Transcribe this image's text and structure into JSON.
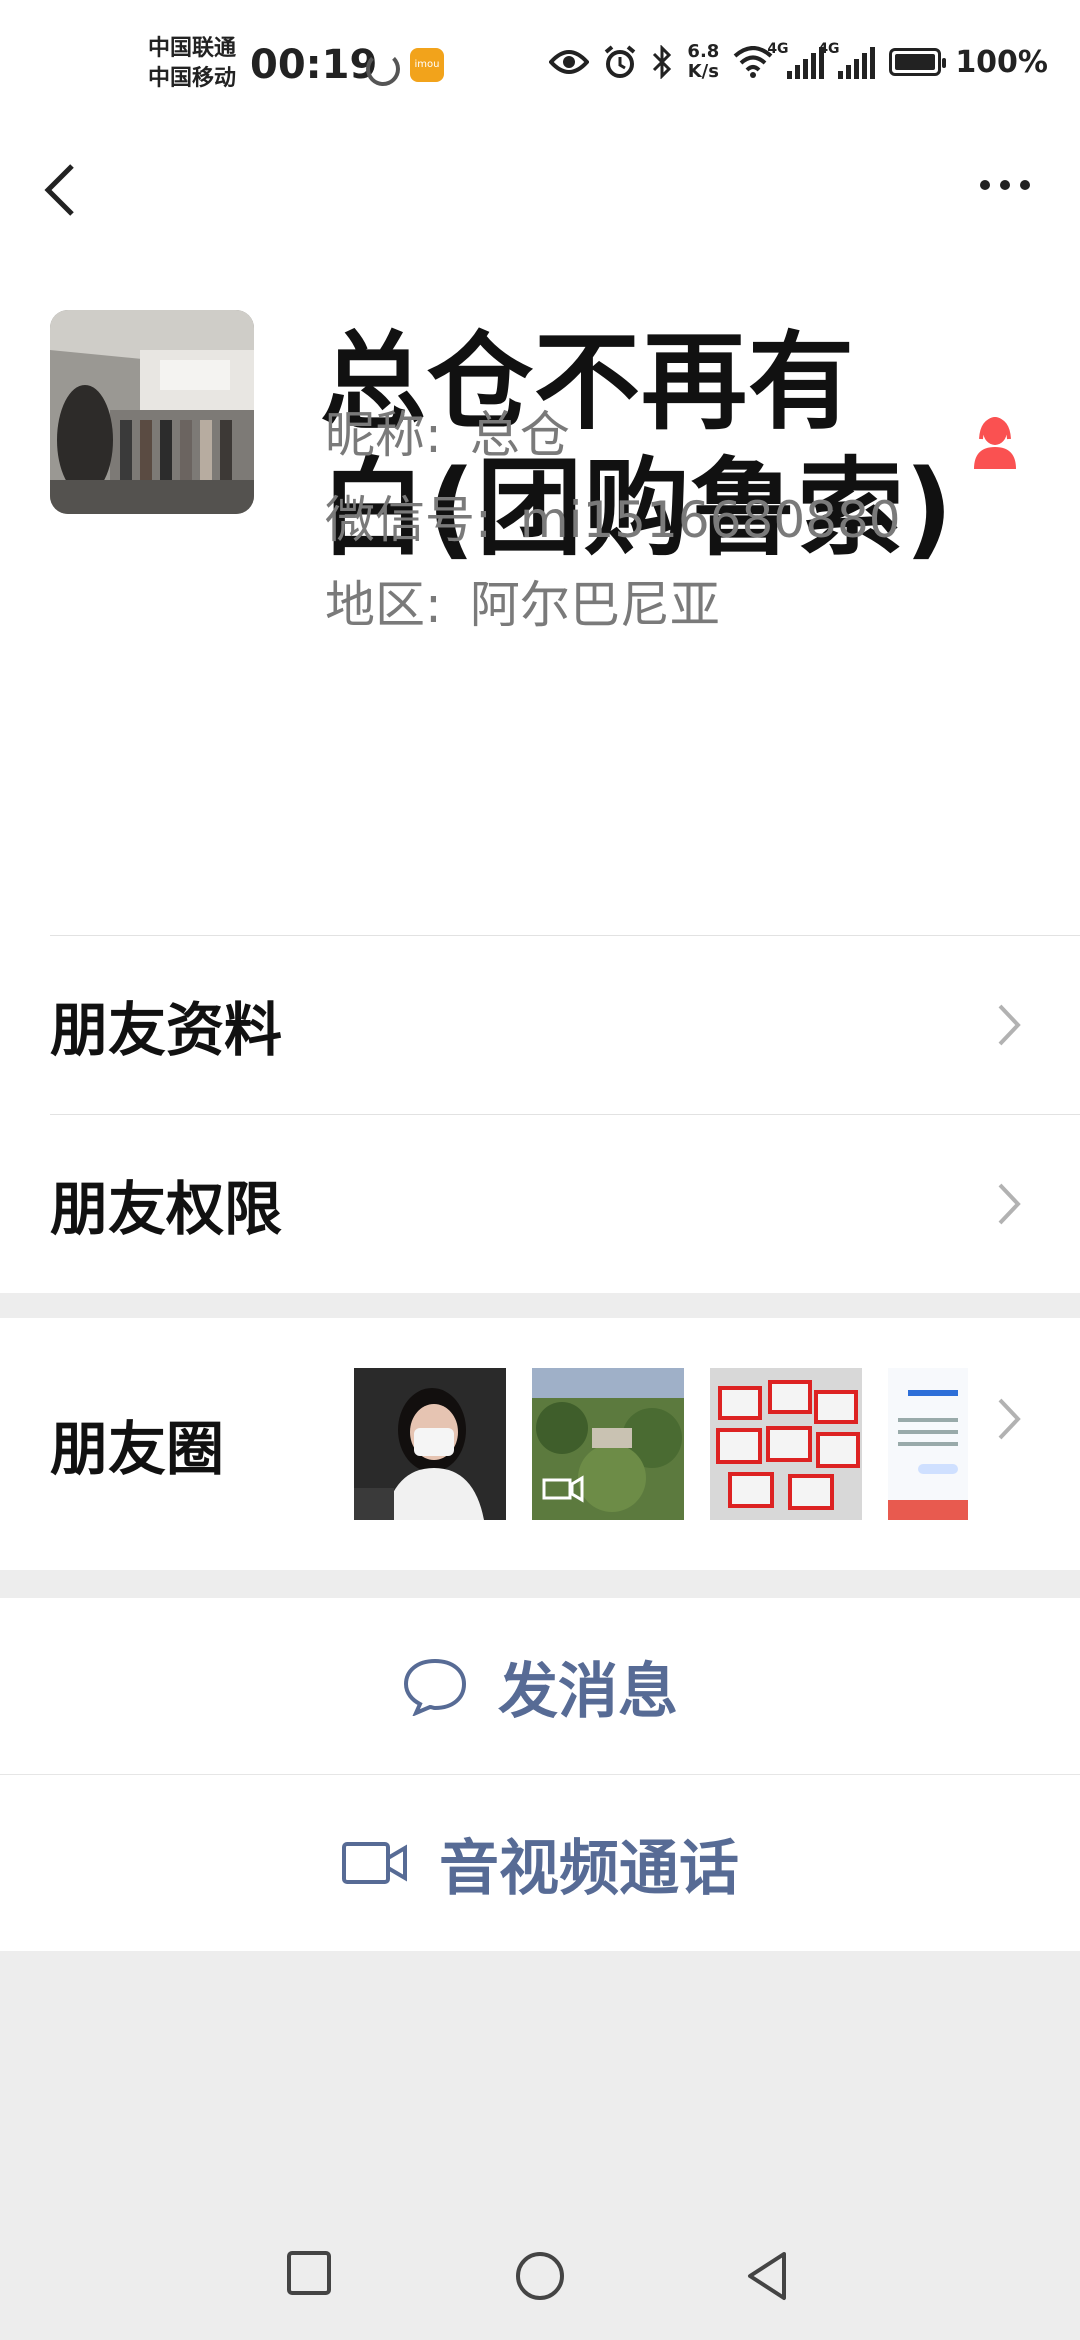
{
  "status_bar": {
    "carrier_1": "中国联通",
    "carrier_2": "中国移动",
    "time": "00:19",
    "app_badge": "imou",
    "net_speed_value": "6.8",
    "net_speed_unit": "K/s",
    "sig1_type": "4G",
    "sig2_type": "4G",
    "battery": "100%"
  },
  "profile": {
    "name": "总仓不再有白(团购鲁索)",
    "nickname_label": "昵称:",
    "nickname": "总仓",
    "wechat_id_label": "微信号:",
    "wechat_id": "mi1516680880",
    "region_label": "地区:",
    "region": "阿尔巴尼亚"
  },
  "menu": {
    "friend_info": "朋友资料",
    "friend_permissions": "朋友权限",
    "moments": "朋友圈"
  },
  "actions": {
    "send_message": "发消息",
    "video_call": "音视频通话"
  },
  "colors": {
    "link_blue": "#576b95",
    "gender_female": "#fa5151",
    "background": "#ededed"
  }
}
